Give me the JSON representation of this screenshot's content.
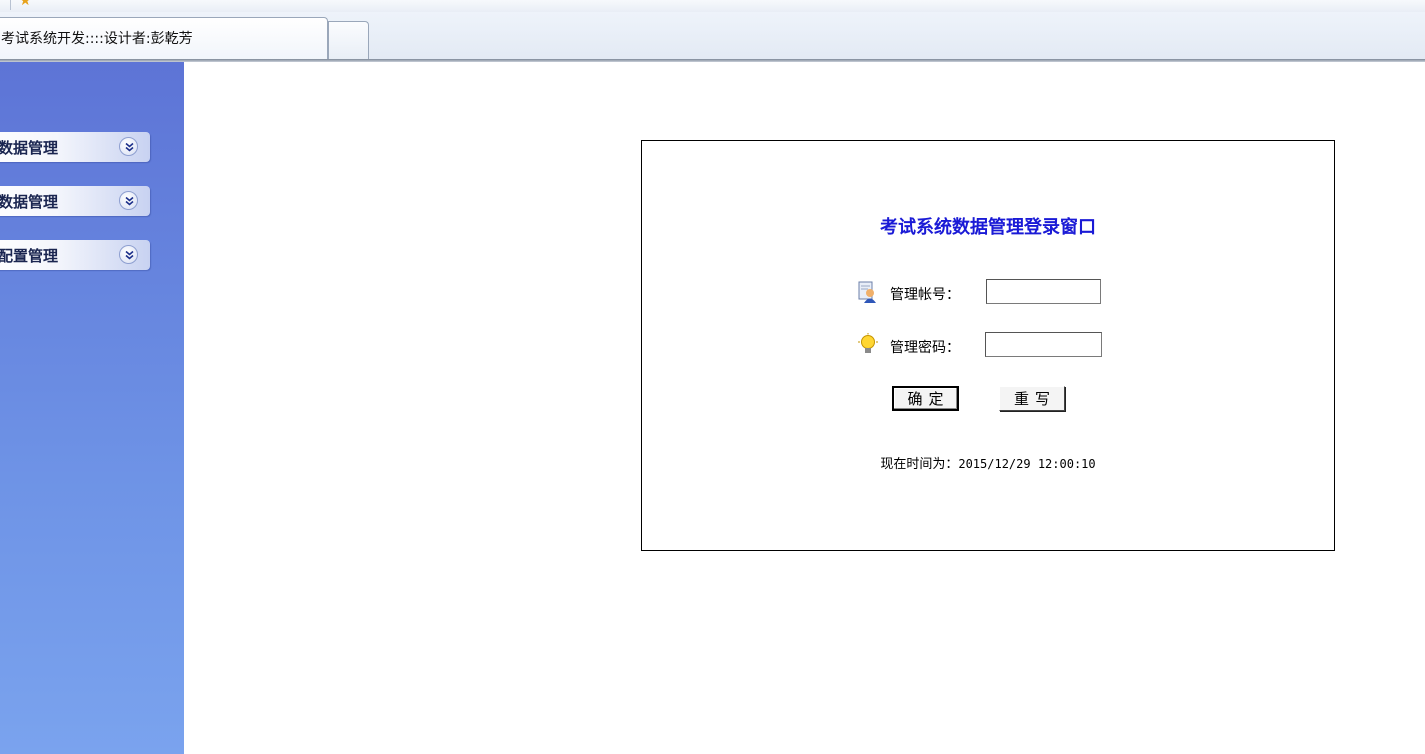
{
  "browser": {
    "tab_title": "考试系统开发::::设计者:彭乾芳"
  },
  "sidebar": {
    "items": [
      {
        "label": "数据管理",
        "icon": "chevron-double-down-icon"
      },
      {
        "label": "数据管理",
        "icon": "chevron-double-down-icon"
      },
      {
        "label": "配置管理",
        "icon": "chevron-double-down-icon"
      }
    ]
  },
  "login": {
    "title": "考试系统数据管理登录窗口",
    "account_label": "管理帐号：",
    "account_value": "",
    "password_label": "管理密码：",
    "password_value": "",
    "ok_button": "确定",
    "reset_button": "重写",
    "time_label": "现在时间为：",
    "time_value": "2015/12/29 12:00:10"
  },
  "colors": {
    "sidebar_top": "#5d74d6",
    "sidebar_bottom": "#7aa3ee",
    "title_blue": "#1a1ad6"
  }
}
